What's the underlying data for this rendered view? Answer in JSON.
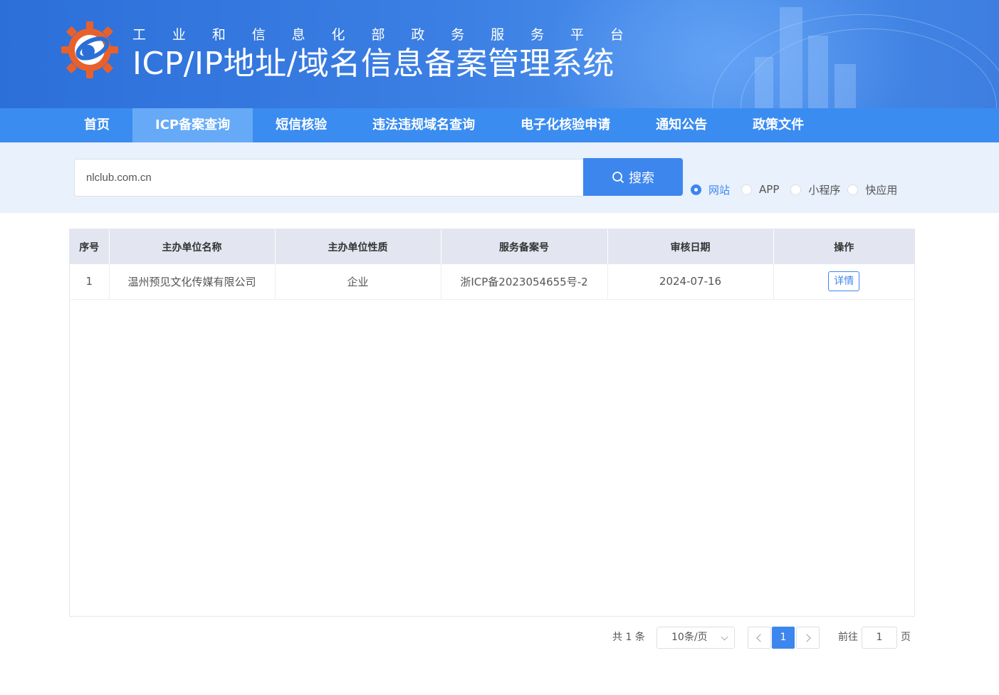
{
  "header": {
    "subtitle_chars": [
      "工",
      "业",
      "和",
      "信",
      "息",
      "化",
      "部",
      "政",
      "务",
      "服",
      "务",
      "平",
      "台"
    ],
    "title": "ICP/IP地址/域名信息备案管理系统"
  },
  "nav": {
    "items": [
      {
        "label": "首页",
        "active": false
      },
      {
        "label": "ICP备案查询",
        "active": true
      },
      {
        "label": "短信核验",
        "active": false
      },
      {
        "label": "违法违规域名查询",
        "active": false
      },
      {
        "label": "电子化核验申请",
        "active": false
      },
      {
        "label": "通知公告",
        "active": false
      },
      {
        "label": "政策文件",
        "active": false
      }
    ]
  },
  "search": {
    "value": "nlclub.com.cn",
    "button_label": "搜索",
    "types": [
      {
        "label": "网站",
        "checked": true
      },
      {
        "label": "APP",
        "checked": false
      },
      {
        "label": "小程序",
        "checked": false
      },
      {
        "label": "快应用",
        "checked": false
      }
    ]
  },
  "table": {
    "columns": [
      "序号",
      "主办单位名称",
      "主办单位性质",
      "服务备案号",
      "审核日期",
      "操作"
    ],
    "rows": [
      {
        "index": "1",
        "org_name": "温州预见文化传媒有限公司",
        "org_type": "企业",
        "license": "浙ICP备2023054655号-2",
        "date": "2024-07-16",
        "action": "详情"
      }
    ]
  },
  "pagination": {
    "total_label": "共 1 条",
    "page_size": "10条/页",
    "current_page": "1",
    "goto_prefix": "前往",
    "goto_value": "1",
    "goto_suffix": "页"
  },
  "colors": {
    "primary": "#3d86ee",
    "nav_bg": "#3a8cf0",
    "nav_active": "#66aaf7",
    "search_band": "#e8f1fc",
    "table_header": "#e3e6f0"
  }
}
